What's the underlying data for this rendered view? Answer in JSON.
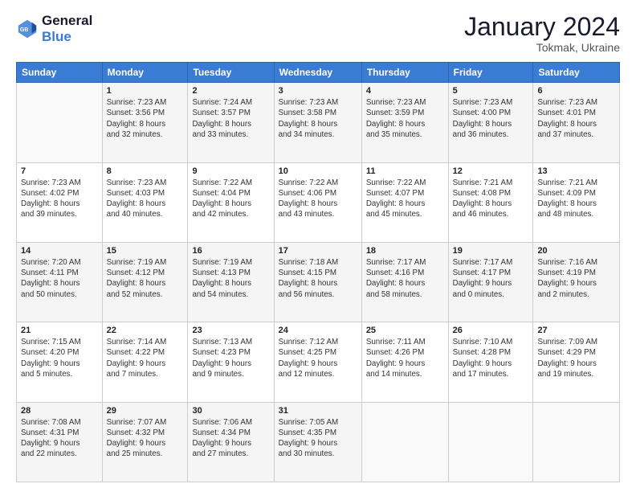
{
  "logo": {
    "line1": "General",
    "line2": "Blue"
  },
  "title": "January 2024",
  "subtitle": "Tokmak, Ukraine",
  "header_days": [
    "Sunday",
    "Monday",
    "Tuesday",
    "Wednesday",
    "Thursday",
    "Friday",
    "Saturday"
  ],
  "weeks": [
    [
      {
        "day": "",
        "info": ""
      },
      {
        "day": "1",
        "info": "Sunrise: 7:23 AM\nSunset: 3:56 PM\nDaylight: 8 hours\nand 32 minutes."
      },
      {
        "day": "2",
        "info": "Sunrise: 7:24 AM\nSunset: 3:57 PM\nDaylight: 8 hours\nand 33 minutes."
      },
      {
        "day": "3",
        "info": "Sunrise: 7:23 AM\nSunset: 3:58 PM\nDaylight: 8 hours\nand 34 minutes."
      },
      {
        "day": "4",
        "info": "Sunrise: 7:23 AM\nSunset: 3:59 PM\nDaylight: 8 hours\nand 35 minutes."
      },
      {
        "day": "5",
        "info": "Sunrise: 7:23 AM\nSunset: 4:00 PM\nDaylight: 8 hours\nand 36 minutes."
      },
      {
        "day": "6",
        "info": "Sunrise: 7:23 AM\nSunset: 4:01 PM\nDaylight: 8 hours\nand 37 minutes."
      }
    ],
    [
      {
        "day": "7",
        "info": "Sunrise: 7:23 AM\nSunset: 4:02 PM\nDaylight: 8 hours\nand 39 minutes."
      },
      {
        "day": "8",
        "info": "Sunrise: 7:23 AM\nSunset: 4:03 PM\nDaylight: 8 hours\nand 40 minutes."
      },
      {
        "day": "9",
        "info": "Sunrise: 7:22 AM\nSunset: 4:04 PM\nDaylight: 8 hours\nand 42 minutes."
      },
      {
        "day": "10",
        "info": "Sunrise: 7:22 AM\nSunset: 4:06 PM\nDaylight: 8 hours\nand 43 minutes."
      },
      {
        "day": "11",
        "info": "Sunrise: 7:22 AM\nSunset: 4:07 PM\nDaylight: 8 hours\nand 45 minutes."
      },
      {
        "day": "12",
        "info": "Sunrise: 7:21 AM\nSunset: 4:08 PM\nDaylight: 8 hours\nand 46 minutes."
      },
      {
        "day": "13",
        "info": "Sunrise: 7:21 AM\nSunset: 4:09 PM\nDaylight: 8 hours\nand 48 minutes."
      }
    ],
    [
      {
        "day": "14",
        "info": "Sunrise: 7:20 AM\nSunset: 4:11 PM\nDaylight: 8 hours\nand 50 minutes."
      },
      {
        "day": "15",
        "info": "Sunrise: 7:19 AM\nSunset: 4:12 PM\nDaylight: 8 hours\nand 52 minutes."
      },
      {
        "day": "16",
        "info": "Sunrise: 7:19 AM\nSunset: 4:13 PM\nDaylight: 8 hours\nand 54 minutes."
      },
      {
        "day": "17",
        "info": "Sunrise: 7:18 AM\nSunset: 4:15 PM\nDaylight: 8 hours\nand 56 minutes."
      },
      {
        "day": "18",
        "info": "Sunrise: 7:17 AM\nSunset: 4:16 PM\nDaylight: 8 hours\nand 58 minutes."
      },
      {
        "day": "19",
        "info": "Sunrise: 7:17 AM\nSunset: 4:17 PM\nDaylight: 9 hours\nand 0 minutes."
      },
      {
        "day": "20",
        "info": "Sunrise: 7:16 AM\nSunset: 4:19 PM\nDaylight: 9 hours\nand 2 minutes."
      }
    ],
    [
      {
        "day": "21",
        "info": "Sunrise: 7:15 AM\nSunset: 4:20 PM\nDaylight: 9 hours\nand 5 minutes."
      },
      {
        "day": "22",
        "info": "Sunrise: 7:14 AM\nSunset: 4:22 PM\nDaylight: 9 hours\nand 7 minutes."
      },
      {
        "day": "23",
        "info": "Sunrise: 7:13 AM\nSunset: 4:23 PM\nDaylight: 9 hours\nand 9 minutes."
      },
      {
        "day": "24",
        "info": "Sunrise: 7:12 AM\nSunset: 4:25 PM\nDaylight: 9 hours\nand 12 minutes."
      },
      {
        "day": "25",
        "info": "Sunrise: 7:11 AM\nSunset: 4:26 PM\nDaylight: 9 hours\nand 14 minutes."
      },
      {
        "day": "26",
        "info": "Sunrise: 7:10 AM\nSunset: 4:28 PM\nDaylight: 9 hours\nand 17 minutes."
      },
      {
        "day": "27",
        "info": "Sunrise: 7:09 AM\nSunset: 4:29 PM\nDaylight: 9 hours\nand 19 minutes."
      }
    ],
    [
      {
        "day": "28",
        "info": "Sunrise: 7:08 AM\nSunset: 4:31 PM\nDaylight: 9 hours\nand 22 minutes."
      },
      {
        "day": "29",
        "info": "Sunrise: 7:07 AM\nSunset: 4:32 PM\nDaylight: 9 hours\nand 25 minutes."
      },
      {
        "day": "30",
        "info": "Sunrise: 7:06 AM\nSunset: 4:34 PM\nDaylight: 9 hours\nand 27 minutes."
      },
      {
        "day": "31",
        "info": "Sunrise: 7:05 AM\nSunset: 4:35 PM\nDaylight: 9 hours\nand 30 minutes."
      },
      {
        "day": "",
        "info": ""
      },
      {
        "day": "",
        "info": ""
      },
      {
        "day": "",
        "info": ""
      }
    ]
  ]
}
